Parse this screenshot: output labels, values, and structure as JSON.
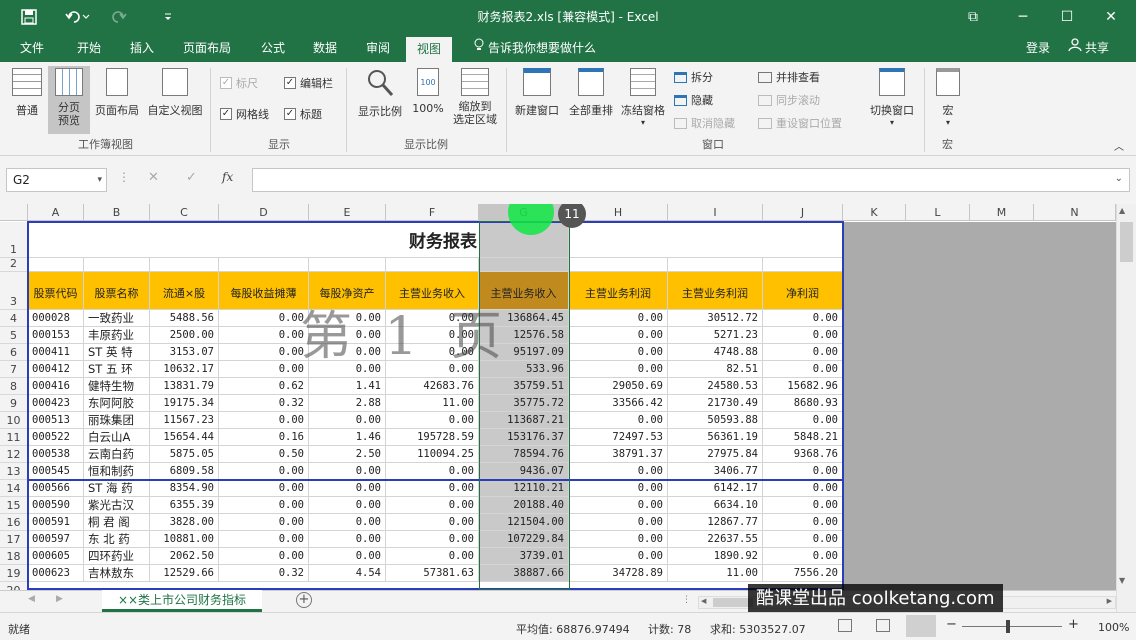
{
  "title_bar": {
    "title": "财务报表2.xls  [兼容模式] - Excel",
    "minimize": "─",
    "maximize": "☐",
    "close": "✕",
    "restore": "⧉"
  },
  "tabs": [
    "文件",
    "开始",
    "插入",
    "页面布局",
    "公式",
    "数据",
    "审阅",
    "视图"
  ],
  "tell_me": "告诉我你想要做什么",
  "login": "登录",
  "share": "共享",
  "ribbon": {
    "normal": "普通",
    "page_break_1": "分页",
    "page_break_2": "预览",
    "page_layout": "页面布局",
    "custom_view": "自定义视图",
    "workbook_views": "工作簿视图",
    "ruler": "标尺",
    "formula_bar": "编辑栏",
    "gridlines": "网格线",
    "headings": "标题",
    "show": "显示",
    "zoom": "显示比例",
    "zoom100": "100%",
    "zoom_sel_1": "缩放到",
    "zoom_sel_2": "选定区域",
    "zoom_group": "显示比例",
    "new_window": "新建窗口",
    "arrange_all": "全部重排",
    "freeze": "冻结窗格",
    "split": "拆分",
    "hide": "隐藏",
    "unhide": "取消隐藏",
    "side_by_side": "并排查看",
    "sync_scroll": "同步滚动",
    "reset_pos": "重设窗口位置",
    "switch_window": "切换窗口",
    "window_group": "窗口",
    "macros": "宏",
    "macros_group": "宏"
  },
  "name_box": "G2",
  "fx": "fx",
  "columns": [
    "A",
    "B",
    "C",
    "D",
    "E",
    "F",
    "G",
    "H",
    "I",
    "J",
    "K",
    "L",
    "M",
    "N"
  ],
  "sheet_title": "财务报表",
  "headers": [
    "股票代码",
    "股票名称",
    "流通×股",
    "每股收益摊薄",
    "每股净资产",
    "主营业务收入",
    "主营业务收入",
    "主营业务利润",
    "主营业务利润",
    "净利润"
  ],
  "rows": [
    {
      "n": "4",
      "c": [
        "000028",
        "一致药业",
        "5488.56",
        "0.00",
        "0.00",
        "0.00",
        "136864.45",
        "0.00",
        "30512.72",
        "0.00"
      ]
    },
    {
      "n": "5",
      "c": [
        "000153",
        "丰原药业",
        "2500.00",
        "0.00",
        "0.00",
        "0.00",
        "12576.58",
        "0.00",
        "5271.23",
        "0.00"
      ]
    },
    {
      "n": "6",
      "c": [
        "000411",
        "ST 英 特",
        "3153.07",
        "0.00",
        "0.00",
        "0.00",
        "95197.09",
        "0.00",
        "4748.88",
        "0.00"
      ]
    },
    {
      "n": "7",
      "c": [
        "000412",
        "ST 五 环",
        "10632.17",
        "0.00",
        "0.00",
        "0.00",
        "533.96",
        "0.00",
        "82.51",
        "0.00"
      ]
    },
    {
      "n": "8",
      "c": [
        "000416",
        "健特生物",
        "13831.79",
        "0.62",
        "1.41",
        "42683.76",
        "35759.51",
        "29050.69",
        "24580.53",
        "15682.96"
      ]
    },
    {
      "n": "9",
      "c": [
        "000423",
        "东阿阿胶",
        "19175.34",
        "0.32",
        "2.88",
        "11.00",
        "35775.72",
        "33566.42",
        "21730.49",
        "8680.93"
      ]
    },
    {
      "n": "10",
      "c": [
        "000513",
        "丽珠集团",
        "11567.23",
        "0.00",
        "0.00",
        "0.00",
        "113687.21",
        "0.00",
        "50593.88",
        "0.00"
      ]
    },
    {
      "n": "11",
      "c": [
        "000522",
        "白云山A",
        "15654.44",
        "0.16",
        "1.46",
        "195728.59",
        "153176.37",
        "72497.53",
        "56361.19",
        "5848.21"
      ]
    },
    {
      "n": "12",
      "c": [
        "000538",
        "云南白药",
        "5875.05",
        "0.50",
        "2.50",
        "110094.25",
        "78594.76",
        "38791.37",
        "27975.84",
        "9368.76"
      ]
    },
    {
      "n": "13",
      "c": [
        "000545",
        "恒和制药",
        "6809.58",
        "0.00",
        "0.00",
        "0.00",
        "9436.07",
        "0.00",
        "3406.77",
        "0.00"
      ]
    },
    {
      "n": "14",
      "c": [
        "000566",
        "ST 海 药",
        "8354.90",
        "0.00",
        "0.00",
        "0.00",
        "12110.21",
        "0.00",
        "6142.17",
        "0.00"
      ]
    },
    {
      "n": "15",
      "c": [
        "000590",
        "紫光古汉",
        "6355.39",
        "0.00",
        "0.00",
        "0.00",
        "20188.40",
        "0.00",
        "6634.10",
        "0.00"
      ]
    },
    {
      "n": "16",
      "c": [
        "000591",
        "桐 君 阁",
        "3828.00",
        "0.00",
        "0.00",
        "0.00",
        "121504.00",
        "0.00",
        "12867.77",
        "0.00"
      ]
    },
    {
      "n": "17",
      "c": [
        "000597",
        "东 北 药",
        "10881.00",
        "0.00",
        "0.00",
        "0.00",
        "107229.84",
        "0.00",
        "22637.55",
        "0.00"
      ]
    },
    {
      "n": "18",
      "c": [
        "000605",
        "四环药业",
        "2062.50",
        "0.00",
        "0.00",
        "0.00",
        "3739.01",
        "0.00",
        "1890.92",
        "0.00"
      ]
    },
    {
      "n": "19",
      "c": [
        "000623",
        "吉林敖东",
        "12529.66",
        "0.32",
        "4.54",
        "57381.63",
        "38887.66",
        "34728.89",
        "11.00",
        "7556.20"
      ]
    }
  ],
  "watermark": "第 1 页",
  "badge": "11",
  "sheet_tab": "××类上市公司财务指标",
  "add_sheet": "+",
  "status": {
    "ready": "就绪",
    "average": "平均值: 68876.97494",
    "count": "计数: 78",
    "sum": "求和: 5303527.07",
    "zoom": "100%"
  },
  "brand": "酷课堂出品 coolketang.com"
}
